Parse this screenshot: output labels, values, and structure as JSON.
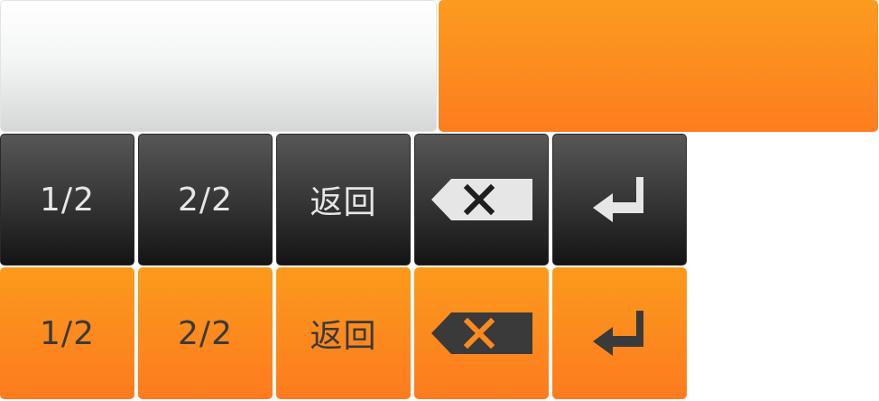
{
  "swatches": {
    "light_color": "#f4f5f5",
    "accent_color": "#fd8a1f"
  },
  "keyboard": {
    "dark_row": {
      "bg_color": "#3a3a3a",
      "fg_color": "#e6e6e6",
      "keys": [
        {
          "label": "1/2"
        },
        {
          "label": "2/2"
        },
        {
          "label": "返回"
        },
        {
          "icon": "backspace-icon"
        },
        {
          "icon": "enter-icon"
        }
      ]
    },
    "orange_row": {
      "bg_color": "#fd8a1f",
      "fg_color": "#3a3a3a",
      "keys": [
        {
          "label": "1/2"
        },
        {
          "label": "2/2"
        },
        {
          "label": "返回"
        },
        {
          "icon": "backspace-icon"
        },
        {
          "icon": "enter-icon"
        }
      ]
    }
  }
}
